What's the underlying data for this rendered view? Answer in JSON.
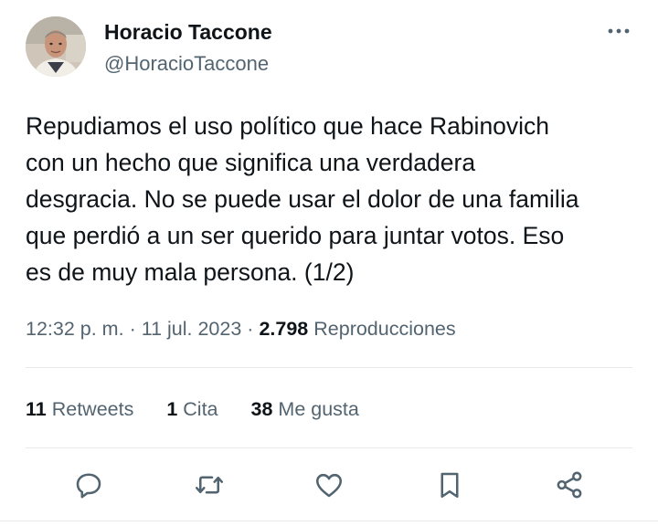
{
  "author": {
    "display_name": "Horacio Taccone",
    "handle": "@HoracioTaccone",
    "avatar_icon": "profile-photo"
  },
  "tweet": {
    "text": "Repudiamos el uso político que hace Rabinovich\ncon un hecho que significa una verdadera\ndesgracia. No se puede usar el dolor de una familia\nque perdió a un ser querido para juntar votos. Eso\nes de muy mala persona. (1/2)",
    "time": "12:32 p. m.",
    "separator": "·",
    "date": "11 jul. 2023",
    "views_count": "2.798",
    "views_label": "Reproducciones"
  },
  "stats": {
    "retweets": {
      "count": "11",
      "label": "Retweets"
    },
    "quotes": {
      "count": "1",
      "label": "Cita"
    },
    "likes": {
      "count": "38",
      "label": "Me gusta"
    }
  },
  "actions": [
    {
      "name": "reply",
      "icon": "reply-icon"
    },
    {
      "name": "retweet",
      "icon": "retweet-icon"
    },
    {
      "name": "like",
      "icon": "heart-icon"
    },
    {
      "name": "bookmark",
      "icon": "bookmark-icon"
    },
    {
      "name": "share",
      "icon": "share-icon"
    }
  ],
  "colors": {
    "primary_text": "#0f1419",
    "secondary_text": "#536471",
    "divider": "#e7e9ea",
    "icon": "#536471"
  }
}
